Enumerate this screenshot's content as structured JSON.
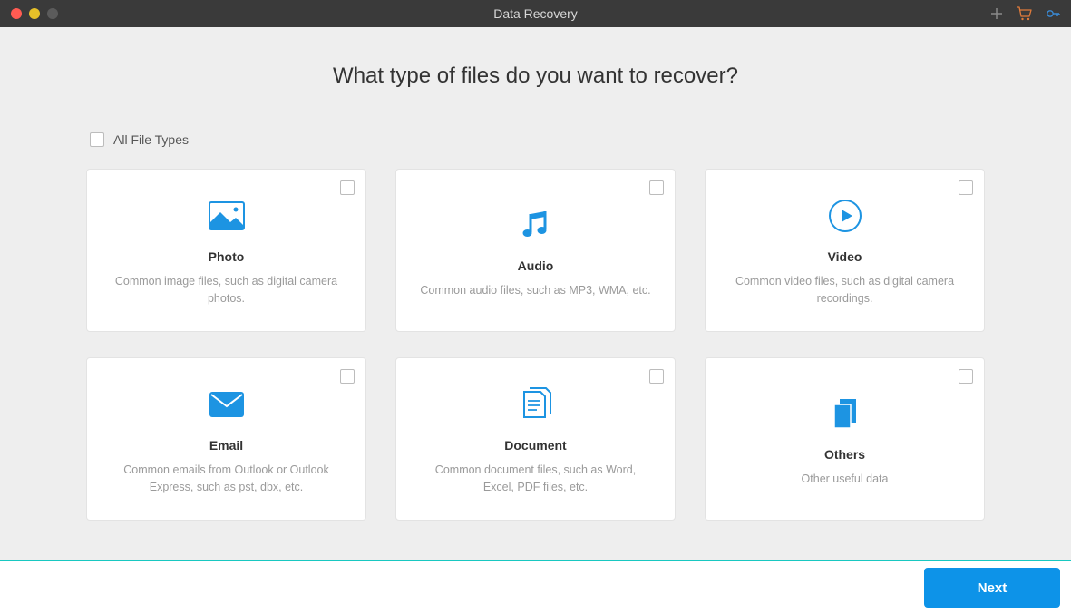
{
  "titlebar": {
    "title": "Data Recovery"
  },
  "heading": "What type of files do you want to recover?",
  "allFiles": {
    "label": "All File Types"
  },
  "cards": [
    {
      "title": "Photo",
      "desc": "Common image files, such as digital camera photos."
    },
    {
      "title": "Audio",
      "desc": "Common audio files, such as MP3, WMA, etc."
    },
    {
      "title": "Video",
      "desc": "Common video files, such as digital camera recordings."
    },
    {
      "title": "Email",
      "desc": "Common emails from Outlook or Outlook Express, such as pst, dbx, etc."
    },
    {
      "title": "Document",
      "desc": "Common document files, such as Word, Excel, PDF files, etc."
    },
    {
      "title": "Others",
      "desc": "Other useful data"
    }
  ],
  "footer": {
    "next": "Next"
  },
  "colors": {
    "accent": "#0d93e8",
    "iconBlue": "#1d94e2",
    "separator": "#18c8c1"
  }
}
